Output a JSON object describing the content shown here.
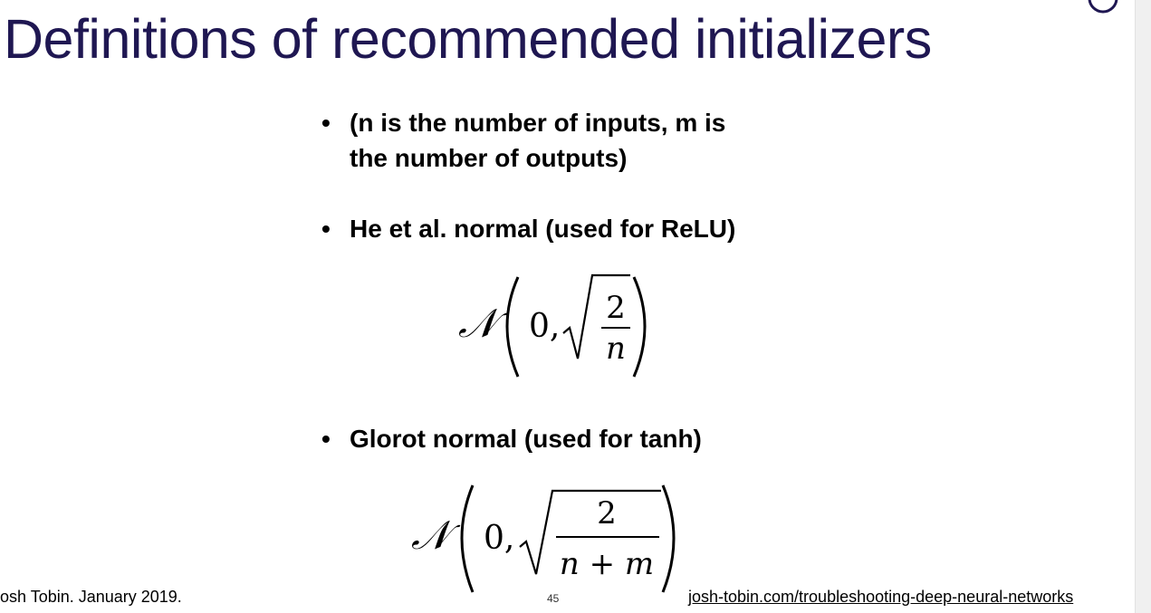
{
  "slide": {
    "title": "Definitions of recommended initializers",
    "bullets": [
      {
        "line1": "(n is the number of inputs, m is",
        "line2": "the number of outputs)"
      },
      {
        "line1": "He et al. normal (used for ReLU)"
      },
      {
        "line1": "Glorot normal (used for tanh)"
      }
    ],
    "formulas": {
      "he": {
        "symbol": "𝒩",
        "zero": "0,",
        "numerator": "2",
        "denominator": "n"
      },
      "glorot": {
        "symbol": "𝒩",
        "zero": "0,",
        "numerator": "2",
        "denominator": "n + m"
      }
    }
  },
  "footer": {
    "author": "osh Tobin. January 2019.",
    "page_number": "45",
    "link": "josh-tobin.com/troubleshooting-deep-neural-networks"
  },
  "colors": {
    "title": "#1f1752"
  }
}
